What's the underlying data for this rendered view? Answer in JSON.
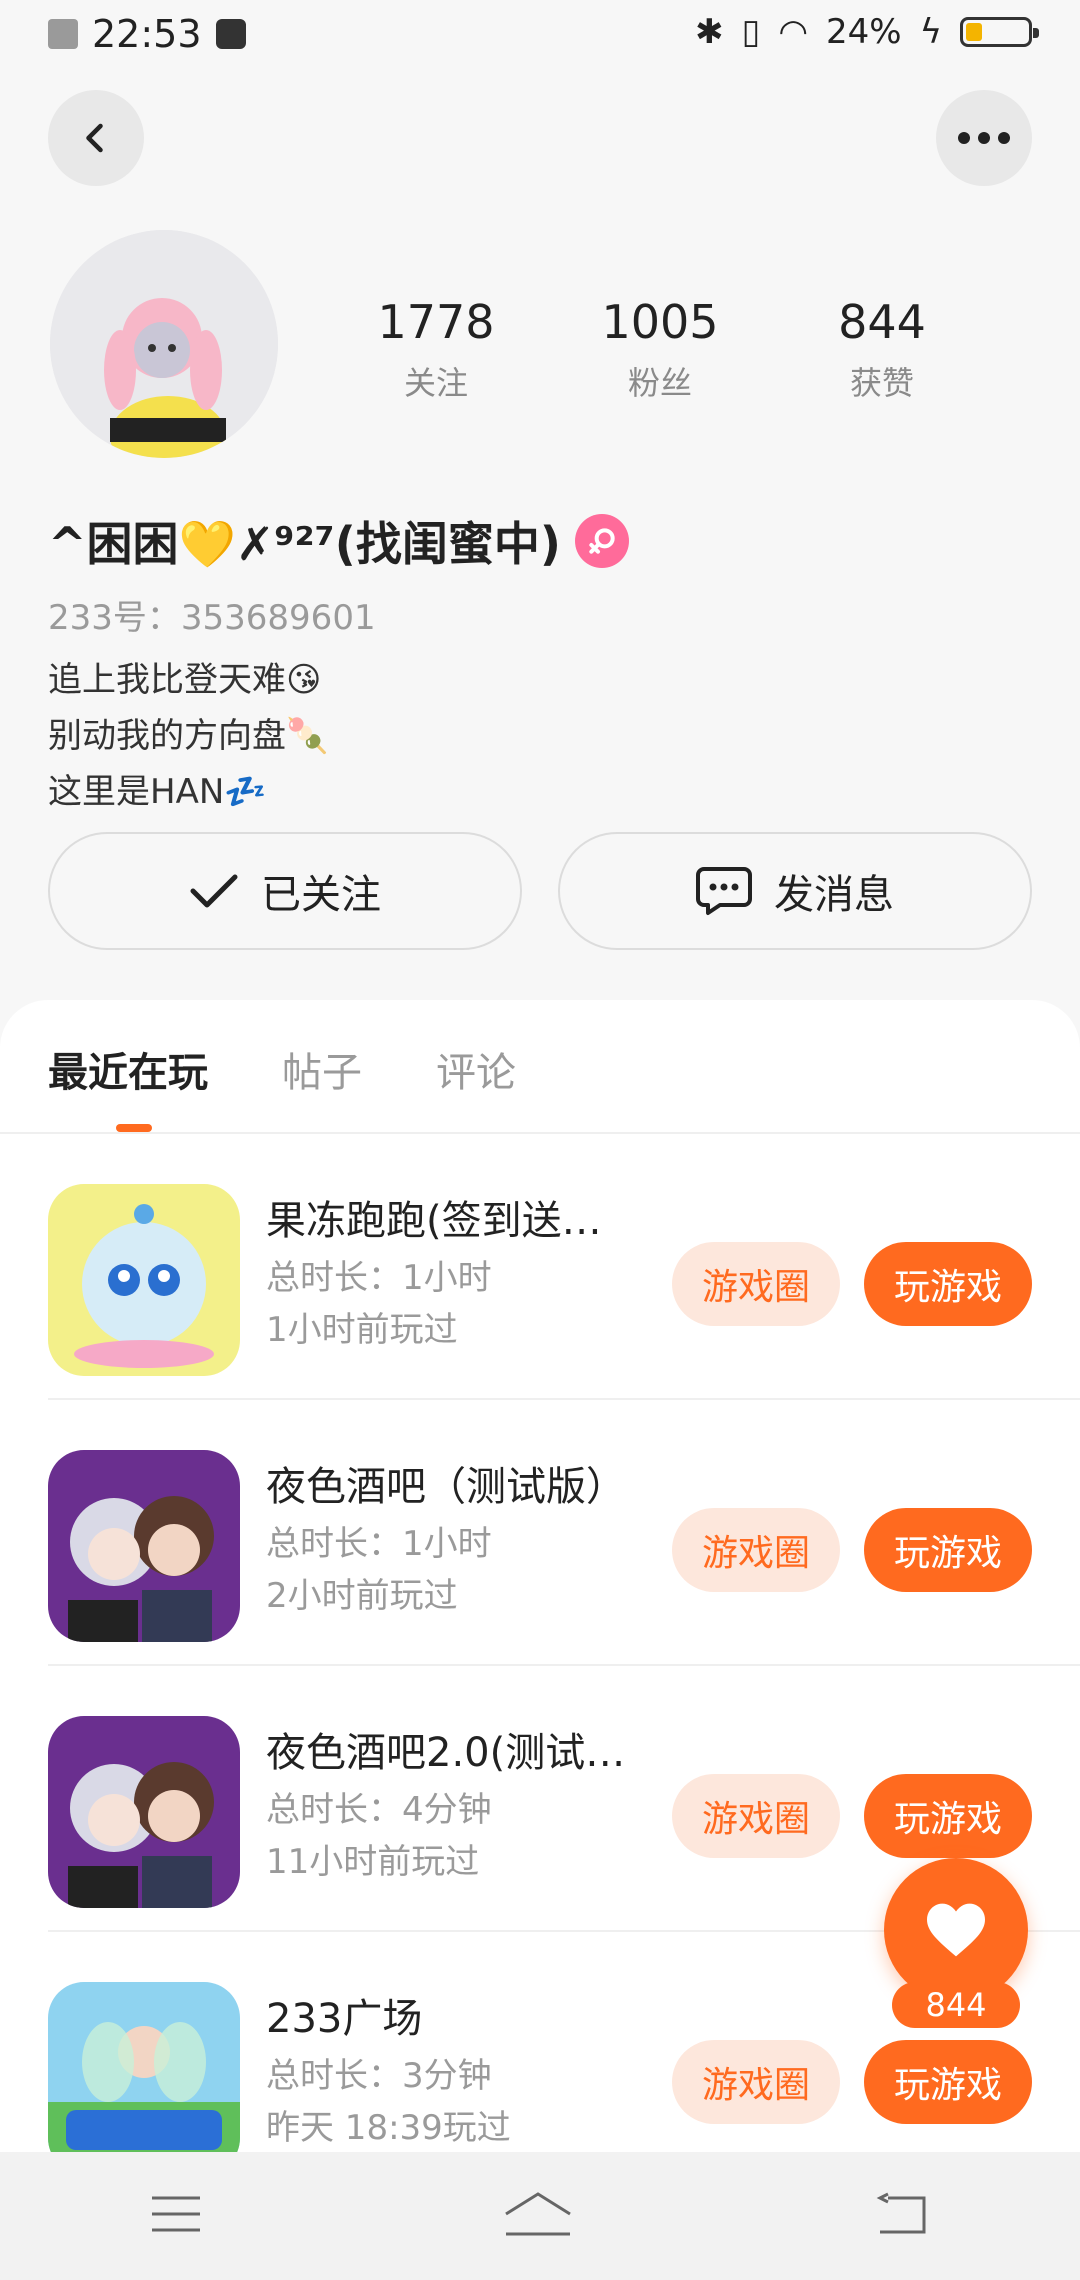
{
  "status_bar": {
    "time": "22:53",
    "battery": "24%"
  },
  "stats": [
    {
      "value": "1778",
      "label": "关注"
    },
    {
      "value": "1005",
      "label": "粉丝"
    },
    {
      "value": "844",
      "label": "获赞"
    }
  ],
  "profile": {
    "name": "^困困💛✗⁹²⁷(找闺蜜中)",
    "uid": "233号：353689601",
    "bio_lines": [
      "追上我比登天难😘",
      "别动我的方向盘🍡",
      "这里是HAN💤"
    ]
  },
  "actions": {
    "follow_label": "已关注",
    "message_label": "发消息"
  },
  "tabs": [
    "最近在玩",
    "帖子",
    "评论"
  ],
  "games": [
    {
      "title": "果冻跑跑(签到送…",
      "duration": "总时长：1小时",
      "last_played": "1小时前玩过",
      "circle_label": "游戏圈",
      "play_label": "玩游戏"
    },
    {
      "title": "夜色酒吧（测试版）",
      "duration": "总时长：1小时",
      "last_played": "2小时前玩过",
      "circle_label": "游戏圈",
      "play_label": "玩游戏"
    },
    {
      "title": "夜色酒吧2.0(测试…",
      "duration": "总时长：4分钟",
      "last_played": "11小时前玩过",
      "circle_label": "游戏圈",
      "play_label": "玩游戏"
    },
    {
      "title": "233广场",
      "duration": "总时长：3分钟",
      "last_played": "昨天 18:39玩过",
      "circle_label": "游戏圈",
      "play_label": "玩游戏"
    }
  ],
  "like_fab": {
    "count": "844"
  },
  "colors": {
    "accent": "#ff6a1f",
    "accent_soft": "#fde7dc"
  }
}
